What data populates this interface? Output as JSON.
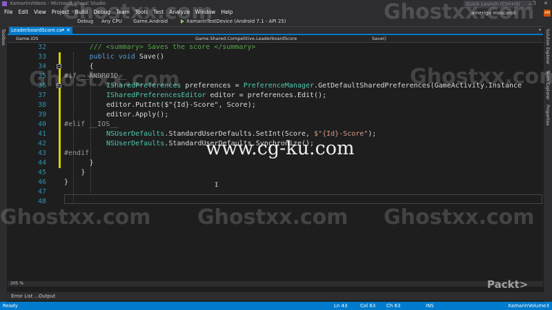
{
  "window": {
    "title": "XamarinVideos - Microsoft Visual Studio",
    "controls": [
      "—",
      "❐",
      "✕"
    ]
  },
  "menu": [
    "File",
    "Edit",
    "View",
    "Project",
    "Build",
    "Debug",
    "Team",
    "Tools",
    "Test",
    "Analyze",
    "Window",
    "Help"
  ],
  "quick_launch": {
    "placeholder": "Quick Launch (Ctrl+Q)",
    "icon": "search-icon"
  },
  "user": {
    "name": "amerigo moscaroli",
    "initials": "AM"
  },
  "toolbar": {
    "config": "Debug",
    "platform": "Any CPU",
    "project": "Game.Android",
    "device": "XamarinTestDevice (Android 7.1 - API 25)"
  },
  "tabs": [
    {
      "label": "LeaderboardScore.cs*",
      "pin": "⊸",
      "close": "✕"
    }
  ],
  "tab_dropdown": "▾",
  "navbar": {
    "project": "Game.iOS",
    "class": "Game.Shared.Competitive.LeaderboardScore",
    "member": "Save()"
  },
  "side_panels": {
    "left": "Toolbox",
    "right": [
      "Solution Explorer",
      "Team Explorer",
      "Properties"
    ]
  },
  "code": [
    {
      "n": "32",
      "change": "",
      "tokens": [
        {
          "t": "/// <summary> Saves the score </summary>",
          "c": "com"
        }
      ]
    },
    {
      "n": "33",
      "change": "yellow",
      "tokens": [
        {
          "t": "public",
          "c": "kw"
        },
        {
          "t": " ",
          "c": "id"
        },
        {
          "t": "void",
          "c": "kw"
        },
        {
          "t": " Save()",
          "c": "id"
        }
      ]
    },
    {
      "n": "34",
      "change": "yellow",
      "collapse": "−",
      "tokens": [
        {
          "t": "{",
          "c": "id"
        }
      ]
    },
    {
      "n": "35",
      "change": "yellow",
      "tokens": [
        {
          "t": "#if __ANDROID__",
          "c": "pp"
        }
      ]
    },
    {
      "n": "36",
      "change": "yellow",
      "collapse": "−",
      "tokens": [
        {
          "t": "ISharedPreferences",
          "c": "type"
        },
        {
          "t": " preferences = ",
          "c": "id"
        },
        {
          "t": "PreferenceManager",
          "c": "type"
        },
        {
          "t": ".GetDefaultSharedPreferences(GameActivity.Instance",
          "c": "id"
        }
      ]
    },
    {
      "n": "37",
      "change": "yellow",
      "tokens": [
        {
          "t": "ISharedPreferencesEditor",
          "c": "type"
        },
        {
          "t": " editor = preferences.Edit();",
          "c": "id"
        }
      ]
    },
    {
      "n": "38",
      "change": "yellow",
      "tokens": [
        {
          "t": "editor.PutInt($\"{Id}-Score\", Score);",
          "c": "id"
        }
      ]
    },
    {
      "n": "39",
      "change": "yellow",
      "tokens": [
        {
          "t": "editor.Apply();",
          "c": "id"
        }
      ]
    },
    {
      "n": "40",
      "change": "yellow",
      "tokens": [
        {
          "t": "#elif __IOS__",
          "c": "pp"
        }
      ]
    },
    {
      "n": "41",
      "change": "yellow",
      "tokens": [
        {
          "t": "NSUserDefaults",
          "c": "type"
        },
        {
          "t": ".StandardUserDefaults.SetInt(Score, ",
          "c": "id"
        },
        {
          "t": "$\"{Id}-Score\"",
          "c": "str"
        },
        {
          "t": ");",
          "c": "id"
        }
      ]
    },
    {
      "n": "42",
      "change": "yellow",
      "tokens": [
        {
          "t": "NSUserDefaults",
          "c": "type"
        },
        {
          "t": ".StandardUserDefaults.Synchronize();",
          "c": "id"
        }
      ]
    },
    {
      "n": "43",
      "change": "yellow",
      "tokens": [
        {
          "t": "#endif",
          "c": "pp"
        }
      ]
    },
    {
      "n": "44",
      "change": "yellow",
      "tokens": [
        {
          "t": "}",
          "c": "id"
        }
      ]
    },
    {
      "n": "45",
      "change": "",
      "tokens": [
        {
          "t": "}",
          "c": "id"
        }
      ]
    },
    {
      "n": "46",
      "change": "",
      "tokens": [
        {
          "t": "}",
          "c": "id"
        }
      ]
    },
    {
      "n": "47",
      "change": "",
      "tokens": []
    },
    {
      "n": "48",
      "change": "",
      "tokens": []
    }
  ],
  "zoom": "205 %",
  "bottom_tabs": [
    "Error List ...",
    "Output"
  ],
  "status": {
    "left": "Ready",
    "ln": "Ln 43",
    "col": "Col 63",
    "ch": "Ch 63",
    "mode": "INS",
    "branch": "XamarinVolume3"
  },
  "watermarks": [
    "Ghostxx.com",
    "www.cg-ku.com"
  ],
  "brand": "Packt>"
}
